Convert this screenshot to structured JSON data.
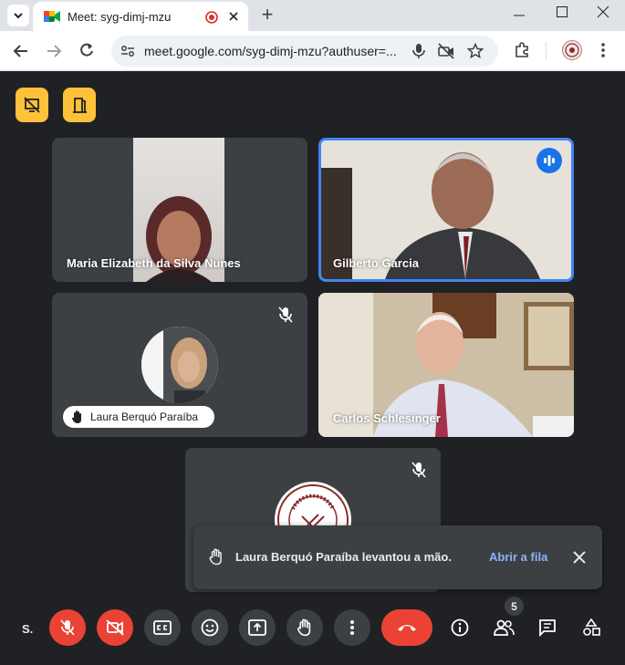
{
  "browser": {
    "tab_title": "Meet: syg-dimj-mzu",
    "url": "meet.google.com/syg-dimj-mzu?authuser=...",
    "new_tab_label": "+"
  },
  "participants": [
    {
      "name": "Maria Elizabeth da Silva Nunes",
      "speaking": false,
      "muted": false
    },
    {
      "name": "Gilberto Garcia",
      "speaking": true,
      "muted": false
    },
    {
      "name": "Laura Berquó Paraíba",
      "speaking": false,
      "muted": true,
      "hand_raised": true
    },
    {
      "name": "Carlos Schlesinger",
      "speaking": false,
      "muted": false
    },
    {
      "name": "",
      "speaking": false,
      "muted": true
    }
  ],
  "toast": {
    "message": "Laura Berquó Paraíba levantou a mão.",
    "action": "Abrir a fila"
  },
  "controls": {
    "self_initial": "S.",
    "people_count": "5"
  },
  "colors": {
    "accent_blue": "#8ab4f8",
    "speaking_border": "#4285f4",
    "danger_red": "#ea4335",
    "warning_yellow": "#fdc13a"
  }
}
